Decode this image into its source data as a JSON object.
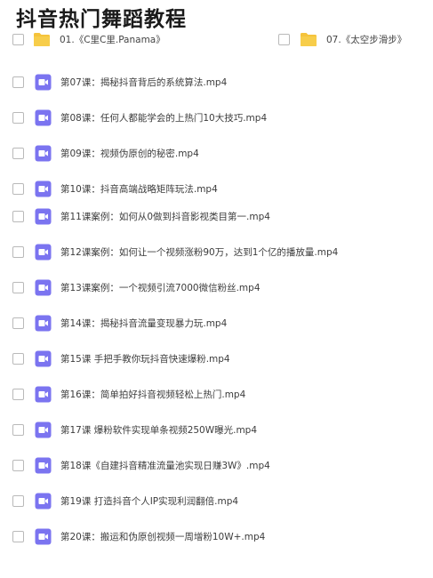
{
  "page": {
    "title": "抖音热门舞蹈教程"
  },
  "folders": [
    {
      "label": "01.《C里C里.Panama》"
    },
    {
      "label": "07.《太空步滑步》"
    }
  ],
  "files": [
    {
      "label": "第07课：揭秘抖音背后的系统算法.mp4"
    },
    {
      "label": "第08课：任何人都能学会的上热门10大技巧.mp4"
    },
    {
      "label": "第09课：视频伪原创的秘密.mp4"
    },
    {
      "label": "第10课：抖音高端战略矩阵玩法.mp4"
    },
    {
      "label": "第11课案例：如何从0做到抖音影视类目第一.mp4"
    },
    {
      "label": "第12课案例：如何让一个视频涨粉90万，达到1个亿的播放量.mp4"
    },
    {
      "label": "第13课案例：一个视频引流7000微信粉丝.mp4"
    },
    {
      "label": "第14课：揭秘抖音流量变现暴力玩.mp4"
    },
    {
      "label": "第15课 手把手教你玩抖音快速爆粉.mp4"
    },
    {
      "label": "第16课：简单拍好抖音视频轻松上热门.mp4"
    },
    {
      "label": "第17课 爆粉软件实现单条视频250W曝光.mp4"
    },
    {
      "label": "第18课《自建抖音精准流量池实现日赚3W》.mp4"
    },
    {
      "label": "第19课 打造抖音个人IP实现利润翻倍.mp4"
    },
    {
      "label": "第20课：搬运和伪原创视频一周增粉10W+.mp4"
    }
  ],
  "icons": {
    "folder": "folder-icon",
    "video": "video-file-icon",
    "checkbox": "checkbox"
  },
  "colors": {
    "folder": "#f5c33b",
    "video": "#7b74f0",
    "checkbox_border": "#b9b9b9"
  }
}
